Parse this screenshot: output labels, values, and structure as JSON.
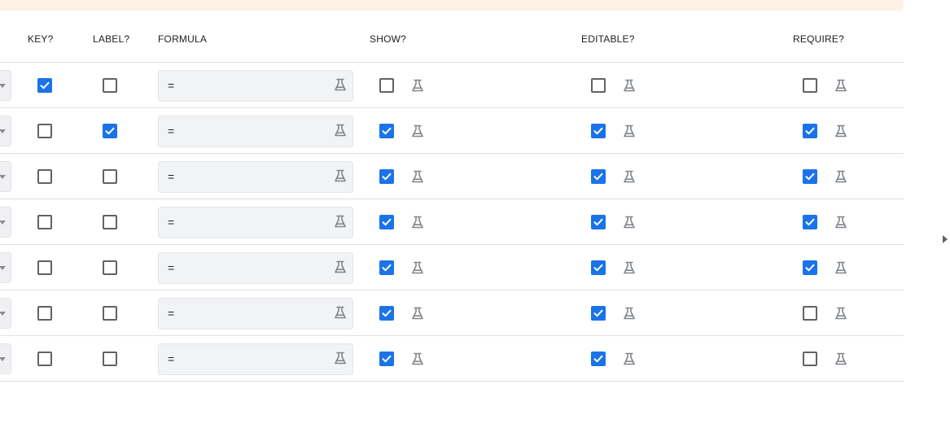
{
  "columns": {
    "key": "KEY?",
    "label": "LABEL?",
    "formula": "FORMULA",
    "show": "SHOW?",
    "editable": "EDITABLE?",
    "require": "REQUIRE?"
  },
  "icons": {
    "formula_flask": "flask-icon",
    "dropdown": "caret-down-icon",
    "expand": "caret-right-icon"
  },
  "colors": {
    "checked": "#1a73e8",
    "banner": "#fdf1e6",
    "icon_gray": "#80868b"
  },
  "rows": [
    {
      "key": true,
      "label": false,
      "formula": "=",
      "show": false,
      "editable": false,
      "require": false
    },
    {
      "key": false,
      "label": true,
      "formula": "=",
      "show": true,
      "editable": true,
      "require": true
    },
    {
      "key": false,
      "label": false,
      "formula": "=",
      "show": true,
      "editable": true,
      "require": true
    },
    {
      "key": false,
      "label": false,
      "formula": "=",
      "show": true,
      "editable": true,
      "require": true
    },
    {
      "key": false,
      "label": false,
      "formula": "=",
      "show": true,
      "editable": true,
      "require": true
    },
    {
      "key": false,
      "label": false,
      "formula": "=",
      "show": true,
      "editable": true,
      "require": false
    },
    {
      "key": false,
      "label": false,
      "formula": "=",
      "show": true,
      "editable": true,
      "require": false
    }
  ]
}
